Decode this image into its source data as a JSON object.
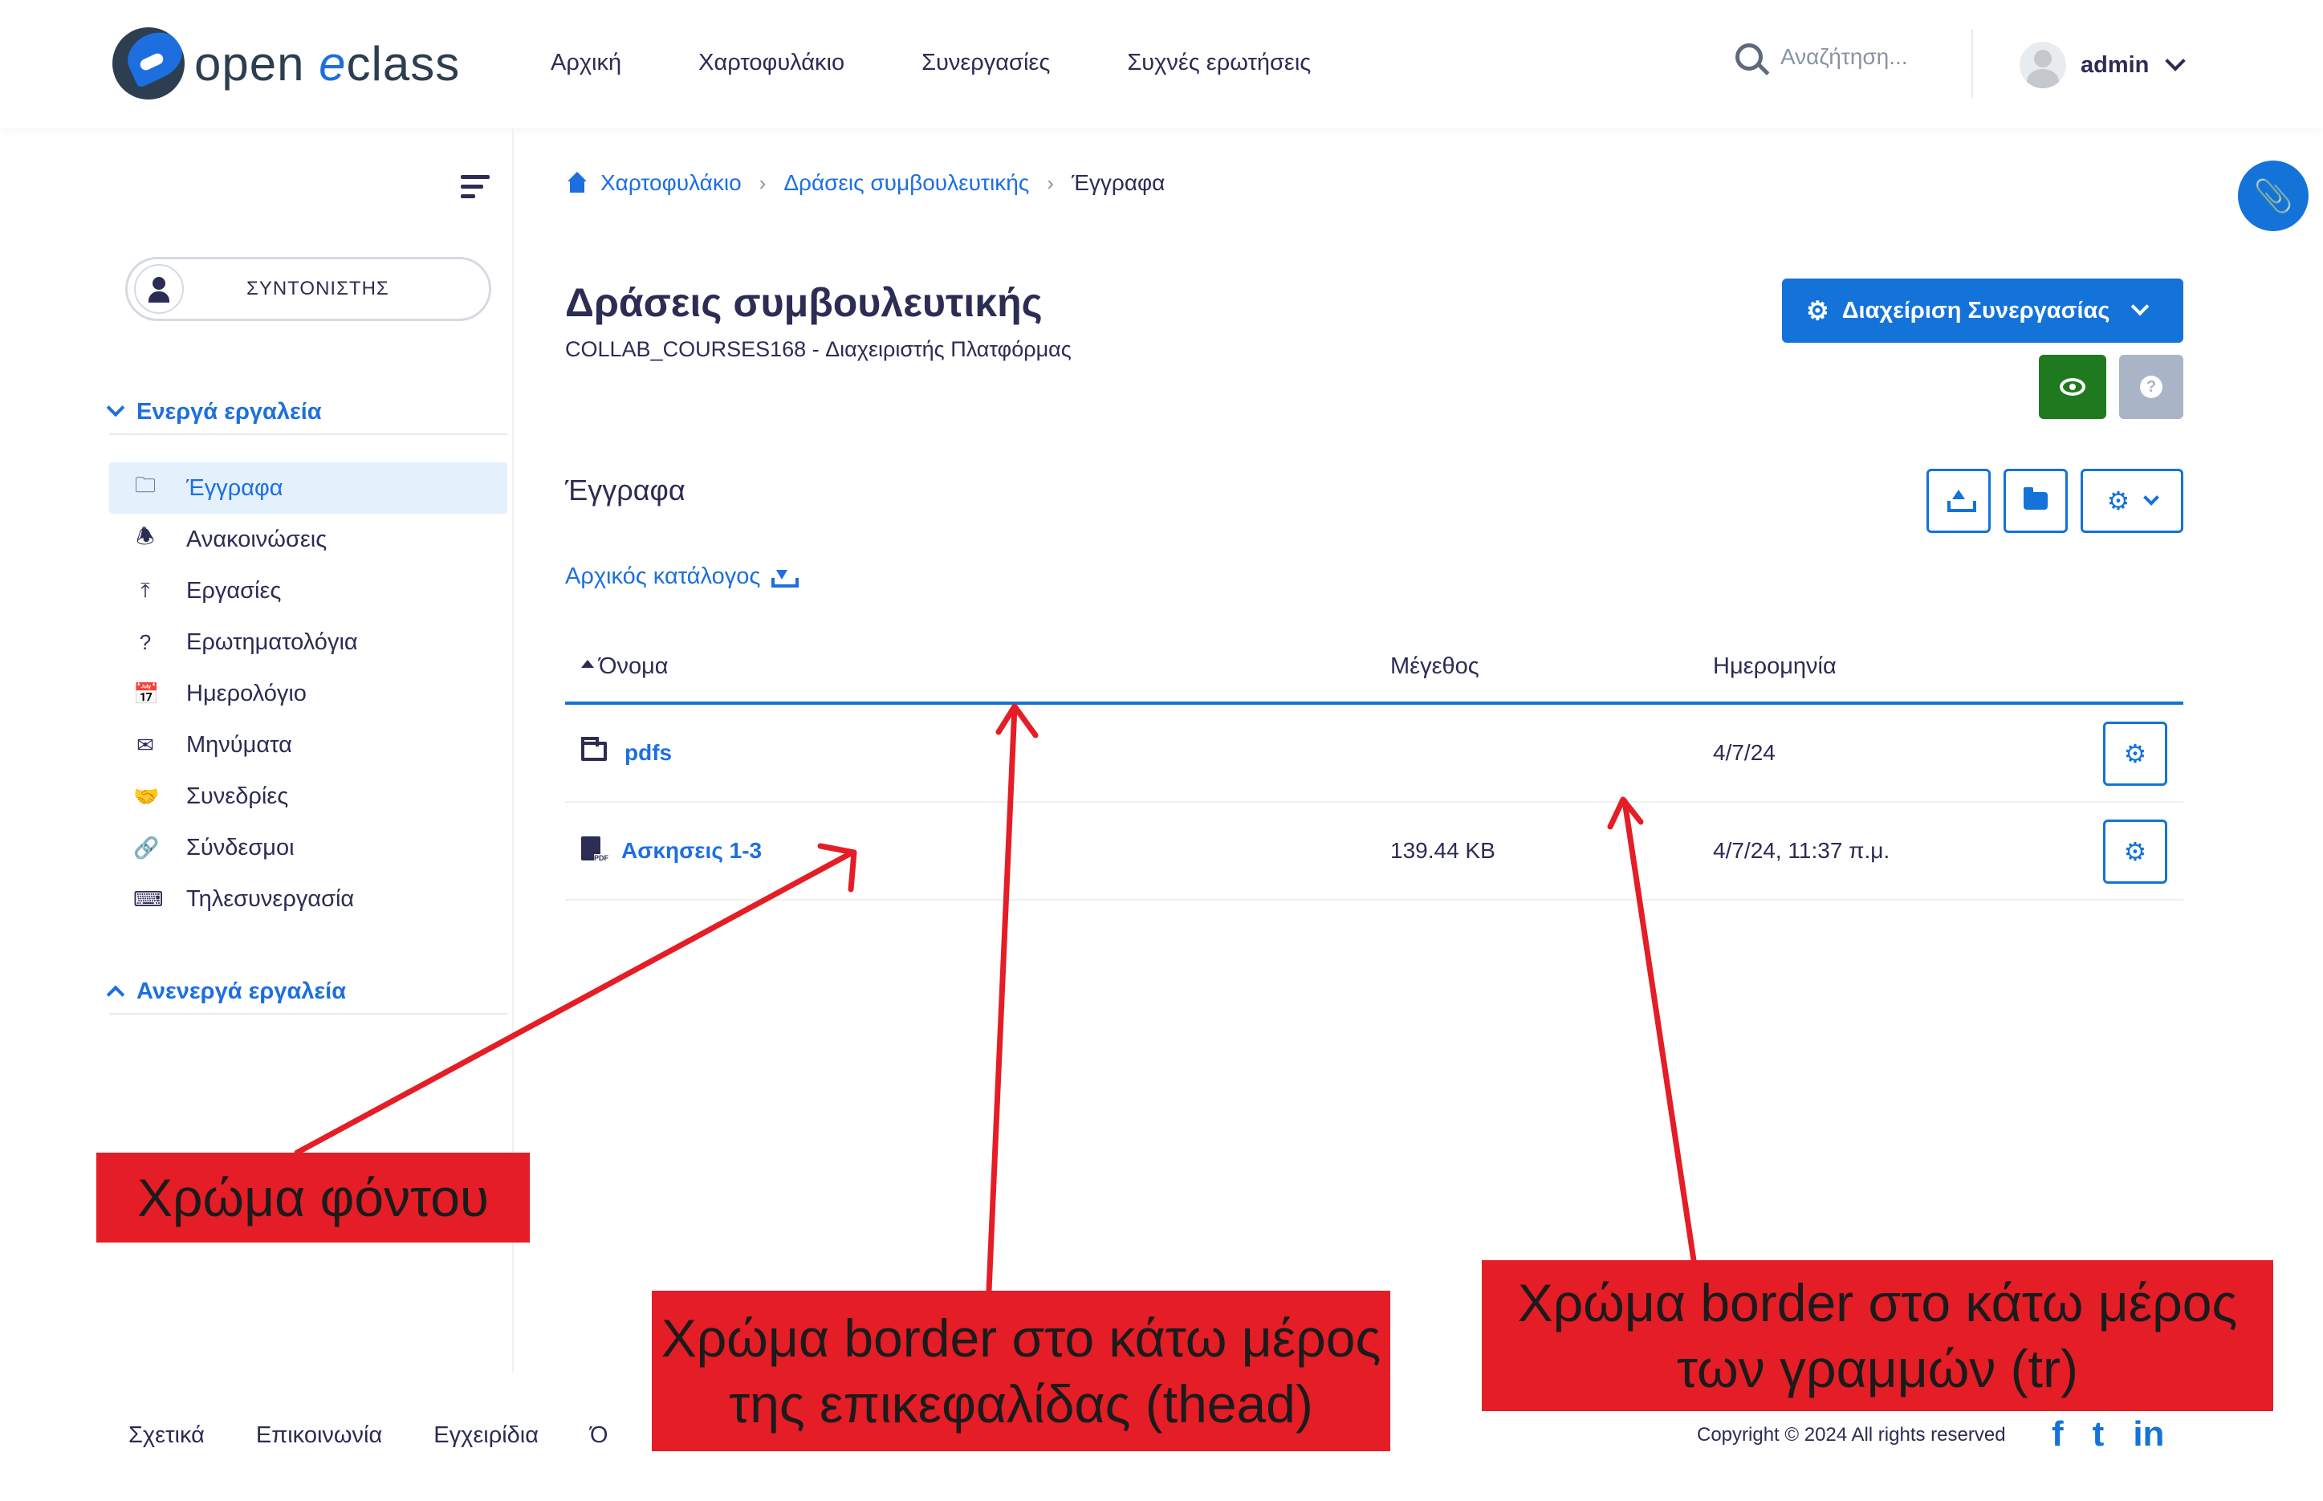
{
  "header": {
    "logo": {
      "prefix": "open ",
      "accent": "e",
      "suffix": "class"
    },
    "nav": [
      "Αρχική",
      "Χαρτοφυλάκιο",
      "Συνεργασίες",
      "Συχνές ερωτήσεις"
    ],
    "search_placeholder": "Αναζήτηση...",
    "user_name": "admin"
  },
  "sidebar": {
    "role": "ΣΥΝΤΟΝΙΣΤΗΣ",
    "active_tools_label": "Ενεργά εργαλεία",
    "inactive_tools_label": "Ανενεργά εργαλεία",
    "tools": [
      {
        "label": "Έγγραφα",
        "icon": "folder-icon",
        "active": true
      },
      {
        "label": "Ανακοινώσεις",
        "icon": "bell-icon",
        "active": false
      },
      {
        "label": "Εργασίες",
        "icon": "upload-icon",
        "active": false
      },
      {
        "label": "Ερωτηματολόγια",
        "icon": "question-icon",
        "active": false
      },
      {
        "label": "Ημερολόγιο",
        "icon": "calendar-icon",
        "active": false
      },
      {
        "label": "Μηνύματα",
        "icon": "envelope-icon",
        "active": false
      },
      {
        "label": "Συνεδρίες",
        "icon": "handshake-icon",
        "active": false
      },
      {
        "label": "Σύνδεσμοι",
        "icon": "link-icon",
        "active": false
      },
      {
        "label": "Τηλεσυνεργασία",
        "icon": "video-conference-icon",
        "active": false
      }
    ]
  },
  "breadcrumb": {
    "items": [
      "Χαρτοφυλάκιο",
      "Δράσεις συμβουλευτικής"
    ],
    "current": "Έγγραφα"
  },
  "course": {
    "title": "Δράσεις συμβουλευτικής",
    "subtitle": "COLLAB_COURSES168  -  Διαχειριστής Πλατφόρμας",
    "manage_label": "Διαχείριση Συνεργασίας"
  },
  "documents": {
    "section_title": "Έγγραφα",
    "root_link": "Αρχικός κατάλογος",
    "columns": {
      "name": "Όνομα",
      "size": "Μέγεθος",
      "date": "Ημερομηνία"
    },
    "rows": [
      {
        "name": "pdfs",
        "type": "folder",
        "size": "",
        "date": "4/7/24"
      },
      {
        "name": "Ασκησεις 1-3",
        "type": "pdf",
        "size": "139.44 KB",
        "date": "4/7/24, 11:37 π.μ."
      }
    ]
  },
  "footer": {
    "links": [
      "Σχετικά",
      "Επικοινωνία",
      "Εγχειρίδια",
      "Ό"
    ],
    "copyright": "Copyright © 2024 All rights reserved",
    "social": [
      "f",
      "t",
      "in"
    ]
  },
  "annotations": {
    "background_color": "Χρώμα φόντου",
    "thead_border": "Χρώμα border στο κάτω μέρος της επικεφαλίδας (thead)",
    "tr_border": "Χρώμα border στο κάτω μέρος των γραμμών (tr)"
  },
  "colors": {
    "primary": "#1373d9",
    "success": "#1f7a1f",
    "annotation": "#e41d26",
    "text": "#2c2c54"
  }
}
